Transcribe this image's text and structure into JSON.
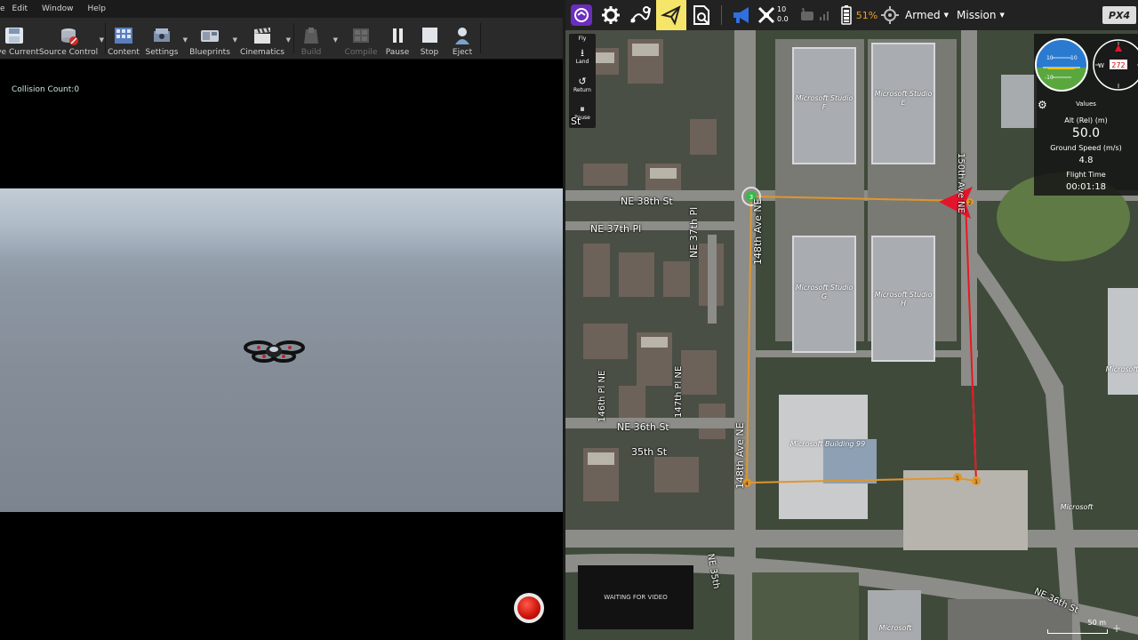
{
  "ue": {
    "menu": [
      "e",
      "Edit",
      "Window",
      "Help"
    ],
    "toolbar": {
      "save_current": "ve Current",
      "source_control": "Source Control",
      "content": "Content",
      "settings": "Settings",
      "blueprints": "Blueprints",
      "cinematics": "Cinematics",
      "build": "Build",
      "compile": "Compile",
      "pause": "Pause",
      "stop": "Stop",
      "eject": "Eject"
    },
    "collision": "Collision Count:0"
  },
  "qgc": {
    "armed": "Armed",
    "mode": "Mission",
    "battery": "51%",
    "gps_count": "10",
    "gps_hdop": "0.0",
    "logo": "PX4",
    "fly_tools": {
      "fly": "Fly",
      "land": "Land",
      "return": "Return",
      "pause": "Pause"
    },
    "values": {
      "title": "Values",
      "alt_label": "Alt (Rel) (m)",
      "alt": "50.0",
      "speed_label": "Ground Speed (m/s)",
      "speed": "4.8",
      "time_label": "Flight Time",
      "time": "00:01:18"
    },
    "compass_heading": "272",
    "compass_dir": "W",
    "attitude_marks": [
      "10",
      "10",
      "-10"
    ],
    "video": "WAITING FOR VIDEO",
    "scale": "50 m",
    "map_labels": {
      "ne38": "NE 38th St",
      "ne37pl": "NE 37th Pl",
      "ne37pl_v": "NE 37th Pl",
      "ne36": "NE 36th St",
      "ne36b": "NE 36th St",
      "ne35": "35th St",
      "ne35_v": "NE 35th",
      "ave148a": "148th Ave NE",
      "ave148b": "148th Ave NE",
      "ave150": "150th Ave NE",
      "ave146": "146th Pl NE",
      "ave147": "147th Pl NE",
      "st": "St",
      "studio_f": "Microsoft Studio F",
      "studio_e": "Microsoft Studio E",
      "studio_g": "Microsoft Studio G",
      "studio_h": "Microsoft Studio H",
      "bldg99": "Microsoft Building 99",
      "ms1": "Microsoft",
      "ms2": "Microsoft",
      "ms3": "Microsoft"
    },
    "waypoints": [
      "1",
      "2",
      "3",
      "4",
      "5"
    ]
  },
  "colors": {
    "mission_line": "#e0962c",
    "track_line": "#e4152a",
    "accent": "#f5e66a",
    "waypoint_start": "#3ab84a"
  }
}
